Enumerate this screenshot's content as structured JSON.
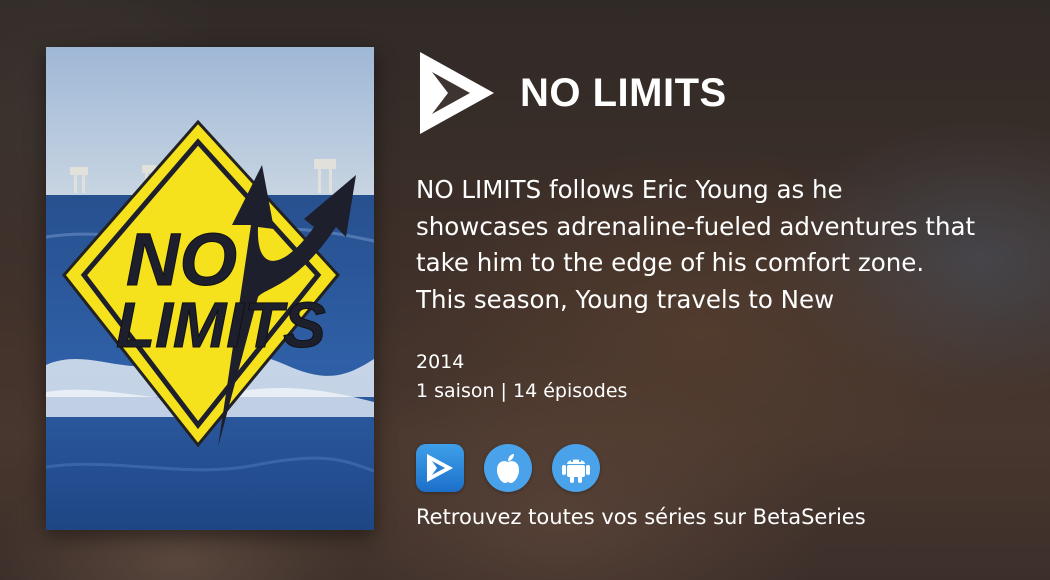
{
  "show": {
    "title": "NO LIMITS",
    "synopsis": "NO LIMITS follows Eric Young as he showcases adrenaline-fueled adventures that take him to the edge of his comfort zone. This season, Young travels to New",
    "year": "2014",
    "seasons_episodes": "1 saison | 14 épisodes",
    "poster": {
      "sign_line1": "NO",
      "sign_line2": "LIMITS"
    }
  },
  "apps": [
    {
      "name": "betaseries-app",
      "icon": "betaseries-play-icon"
    },
    {
      "name": "ios-app",
      "icon": "apple-icon"
    },
    {
      "name": "android-app",
      "icon": "android-icon"
    }
  ],
  "tagline": "Retrouvez toutes vos séries sur BetaSeries",
  "colors": {
    "sign_yellow": "#f5e21c",
    "sign_dark": "#1e1f2c",
    "app_blue": "#4aa3ea"
  }
}
